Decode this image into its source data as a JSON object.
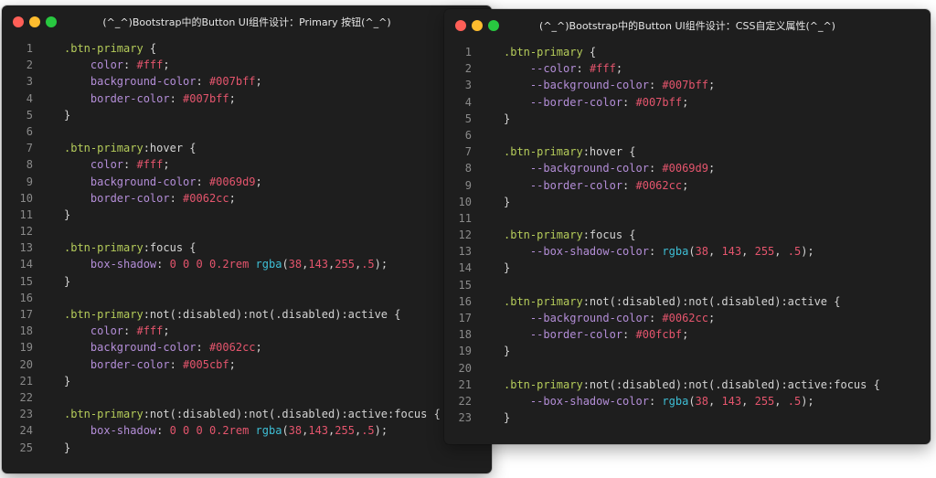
{
  "colors": {
    "selector": "#b5cc5a",
    "property": "#b48ed8",
    "value": "#e5556d",
    "function": "#3ebfd6",
    "plain": "#d4d4d4",
    "line_number": "#8a8a8a",
    "window_bg": "#1e1e1e"
  },
  "windows": [
    {
      "title": "(^_^)Bootstrap中的Button UI组件设计：Primary 按钮(^_^)",
      "lines": [
        {
          "n": "1",
          "tokens": [
            {
              "t": ".btn-primary",
              "k": "sel"
            },
            {
              "t": " {",
              "k": "punc"
            }
          ]
        },
        {
          "n": "2",
          "tokens": [
            {
              "t": "    color",
              "k": "prop"
            },
            {
              "t": ": ",
              "k": "punc"
            },
            {
              "t": "#fff",
              "k": "val"
            },
            {
              "t": ";",
              "k": "punc"
            }
          ]
        },
        {
          "n": "3",
          "tokens": [
            {
              "t": "    background-color",
              "k": "prop"
            },
            {
              "t": ": ",
              "k": "punc"
            },
            {
              "t": "#007bff",
              "k": "val"
            },
            {
              "t": ";",
              "k": "punc"
            }
          ]
        },
        {
          "n": "4",
          "tokens": [
            {
              "t": "    border-color",
              "k": "prop"
            },
            {
              "t": ": ",
              "k": "punc"
            },
            {
              "t": "#007bff",
              "k": "val"
            },
            {
              "t": ";",
              "k": "punc"
            }
          ]
        },
        {
          "n": "5",
          "tokens": [
            {
              "t": "}",
              "k": "punc"
            }
          ]
        },
        {
          "n": "6",
          "tokens": []
        },
        {
          "n": "7",
          "tokens": [
            {
              "t": ".btn-primary",
              "k": "sel"
            },
            {
              "t": ":hover",
              "k": "pseudo"
            },
            {
              "t": " {",
              "k": "punc"
            }
          ]
        },
        {
          "n": "8",
          "tokens": [
            {
              "t": "    color",
              "k": "prop"
            },
            {
              "t": ": ",
              "k": "punc"
            },
            {
              "t": "#fff",
              "k": "val"
            },
            {
              "t": ";",
              "k": "punc"
            }
          ]
        },
        {
          "n": "9",
          "tokens": [
            {
              "t": "    background-color",
              "k": "prop"
            },
            {
              "t": ": ",
              "k": "punc"
            },
            {
              "t": "#0069d9",
              "k": "val"
            },
            {
              "t": ";",
              "k": "punc"
            }
          ]
        },
        {
          "n": "10",
          "tokens": [
            {
              "t": "    border-color",
              "k": "prop"
            },
            {
              "t": ": ",
              "k": "punc"
            },
            {
              "t": "#0062cc",
              "k": "val"
            },
            {
              "t": ";",
              "k": "punc"
            }
          ]
        },
        {
          "n": "11",
          "tokens": [
            {
              "t": "}",
              "k": "punc"
            }
          ]
        },
        {
          "n": "12",
          "tokens": []
        },
        {
          "n": "13",
          "tokens": [
            {
              "t": ".btn-primary",
              "k": "sel"
            },
            {
              "t": ":focus",
              "k": "pseudo"
            },
            {
              "t": " {",
              "k": "punc"
            }
          ]
        },
        {
          "n": "14",
          "tokens": [
            {
              "t": "    box-shadow",
              "k": "prop"
            },
            {
              "t": ": ",
              "k": "punc"
            },
            {
              "t": "0 0 0 0.2rem ",
              "k": "val"
            },
            {
              "t": "rgba",
              "k": "fn"
            },
            {
              "t": "(",
              "k": "punc"
            },
            {
              "t": "38",
              "k": "val"
            },
            {
              "t": ",",
              "k": "punc"
            },
            {
              "t": "143",
              "k": "val"
            },
            {
              "t": ",",
              "k": "punc"
            },
            {
              "t": "255",
              "k": "val"
            },
            {
              "t": ",",
              "k": "punc"
            },
            {
              "t": ".5",
              "k": "val"
            },
            {
              "t": ");",
              "k": "punc"
            }
          ]
        },
        {
          "n": "15",
          "tokens": [
            {
              "t": "}",
              "k": "punc"
            }
          ]
        },
        {
          "n": "16",
          "tokens": []
        },
        {
          "n": "17",
          "tokens": [
            {
              "t": ".btn-primary",
              "k": "sel"
            },
            {
              "t": ":not(:disabled):not(.disabled):active",
              "k": "pseudo"
            },
            {
              "t": " {",
              "k": "punc"
            }
          ]
        },
        {
          "n": "18",
          "tokens": [
            {
              "t": "    color",
              "k": "prop"
            },
            {
              "t": ": ",
              "k": "punc"
            },
            {
              "t": "#fff",
              "k": "val"
            },
            {
              "t": ";",
              "k": "punc"
            }
          ]
        },
        {
          "n": "19",
          "tokens": [
            {
              "t": "    background-color",
              "k": "prop"
            },
            {
              "t": ": ",
              "k": "punc"
            },
            {
              "t": "#0062cc",
              "k": "val"
            },
            {
              "t": ";",
              "k": "punc"
            }
          ]
        },
        {
          "n": "20",
          "tokens": [
            {
              "t": "    border-color",
              "k": "prop"
            },
            {
              "t": ": ",
              "k": "punc"
            },
            {
              "t": "#005cbf",
              "k": "val"
            },
            {
              "t": ";",
              "k": "punc"
            }
          ]
        },
        {
          "n": "21",
          "tokens": [
            {
              "t": "}",
              "k": "punc"
            }
          ]
        },
        {
          "n": "22",
          "tokens": []
        },
        {
          "n": "23",
          "tokens": [
            {
              "t": ".btn-primary",
              "k": "sel"
            },
            {
              "t": ":not(:disabled):not(.disabled):active:focus",
              "k": "pseudo"
            },
            {
              "t": " {",
              "k": "punc"
            }
          ]
        },
        {
          "n": "24",
          "tokens": [
            {
              "t": "    box-shadow",
              "k": "prop"
            },
            {
              "t": ": ",
              "k": "punc"
            },
            {
              "t": "0 0 0 0.2rem ",
              "k": "val"
            },
            {
              "t": "rgba",
              "k": "fn"
            },
            {
              "t": "(",
              "k": "punc"
            },
            {
              "t": "38",
              "k": "val"
            },
            {
              "t": ",",
              "k": "punc"
            },
            {
              "t": "143",
              "k": "val"
            },
            {
              "t": ",",
              "k": "punc"
            },
            {
              "t": "255",
              "k": "val"
            },
            {
              "t": ",",
              "k": "punc"
            },
            {
              "t": ".5",
              "k": "val"
            },
            {
              "t": ");",
              "k": "punc"
            }
          ]
        },
        {
          "n": "25",
          "tokens": [
            {
              "t": "}",
              "k": "punc"
            }
          ]
        }
      ]
    },
    {
      "title": "(^_^)Bootstrap中的Button UI组件设计：CSS自定义属性(^_^)",
      "lines": [
        {
          "n": "1",
          "tokens": [
            {
              "t": ".btn-primary",
              "k": "sel"
            },
            {
              "t": " {",
              "k": "punc"
            }
          ]
        },
        {
          "n": "2",
          "tokens": [
            {
              "t": "    --color",
              "k": "prop"
            },
            {
              "t": ": ",
              "k": "punc"
            },
            {
              "t": "#fff",
              "k": "val"
            },
            {
              "t": ";",
              "k": "punc"
            }
          ]
        },
        {
          "n": "3",
          "tokens": [
            {
              "t": "    --background-color",
              "k": "prop"
            },
            {
              "t": ": ",
              "k": "punc"
            },
            {
              "t": "#007bff",
              "k": "val"
            },
            {
              "t": ";",
              "k": "punc"
            }
          ]
        },
        {
          "n": "4",
          "tokens": [
            {
              "t": "    --border-color",
              "k": "prop"
            },
            {
              "t": ": ",
              "k": "punc"
            },
            {
              "t": "#007bff",
              "k": "val"
            },
            {
              "t": ";",
              "k": "punc"
            }
          ]
        },
        {
          "n": "5",
          "tokens": [
            {
              "t": "}",
              "k": "punc"
            }
          ]
        },
        {
          "n": "6",
          "tokens": []
        },
        {
          "n": "7",
          "tokens": [
            {
              "t": ".btn-primary",
              "k": "sel"
            },
            {
              "t": ":hover",
              "k": "pseudo"
            },
            {
              "t": " {",
              "k": "punc"
            }
          ]
        },
        {
          "n": "8",
          "tokens": [
            {
              "t": "    --background-color",
              "k": "prop"
            },
            {
              "t": ": ",
              "k": "punc"
            },
            {
              "t": "#0069d9",
              "k": "val"
            },
            {
              "t": ";",
              "k": "punc"
            }
          ]
        },
        {
          "n": "9",
          "tokens": [
            {
              "t": "    --border-color",
              "k": "prop"
            },
            {
              "t": ": ",
              "k": "punc"
            },
            {
              "t": "#0062cc",
              "k": "val"
            },
            {
              "t": ";",
              "k": "punc"
            }
          ]
        },
        {
          "n": "10",
          "tokens": [
            {
              "t": "}",
              "k": "punc"
            }
          ]
        },
        {
          "n": "11",
          "tokens": []
        },
        {
          "n": "12",
          "tokens": [
            {
              "t": ".btn-primary",
              "k": "sel"
            },
            {
              "t": ":focus",
              "k": "pseudo"
            },
            {
              "t": " {",
              "k": "punc"
            }
          ]
        },
        {
          "n": "13",
          "tokens": [
            {
              "t": "    --box-shadow-color",
              "k": "prop"
            },
            {
              "t": ": ",
              "k": "punc"
            },
            {
              "t": "rgba",
              "k": "fn"
            },
            {
              "t": "(",
              "k": "punc"
            },
            {
              "t": "38",
              "k": "val"
            },
            {
              "t": ", ",
              "k": "punc"
            },
            {
              "t": "143",
              "k": "val"
            },
            {
              "t": ", ",
              "k": "punc"
            },
            {
              "t": "255",
              "k": "val"
            },
            {
              "t": ", ",
              "k": "punc"
            },
            {
              "t": ".5",
              "k": "val"
            },
            {
              "t": ");",
              "k": "punc"
            }
          ]
        },
        {
          "n": "14",
          "tokens": [
            {
              "t": "}",
              "k": "punc"
            }
          ]
        },
        {
          "n": "15",
          "tokens": []
        },
        {
          "n": "16",
          "tokens": [
            {
              "t": ".btn-primary",
              "k": "sel"
            },
            {
              "t": ":not(:disabled):not(.disabled):active",
              "k": "pseudo"
            },
            {
              "t": " {",
              "k": "punc"
            }
          ]
        },
        {
          "n": "17",
          "tokens": [
            {
              "t": "    --background-color",
              "k": "prop"
            },
            {
              "t": ": ",
              "k": "punc"
            },
            {
              "t": "#0062cc",
              "k": "val"
            },
            {
              "t": ";",
              "k": "punc"
            }
          ]
        },
        {
          "n": "18",
          "tokens": [
            {
              "t": "    --border-color",
              "k": "prop"
            },
            {
              "t": ": ",
              "k": "punc"
            },
            {
              "t": "#00fcbf",
              "k": "val"
            },
            {
              "t": ";",
              "k": "punc"
            }
          ]
        },
        {
          "n": "19",
          "tokens": [
            {
              "t": "}",
              "k": "punc"
            }
          ]
        },
        {
          "n": "20",
          "tokens": []
        },
        {
          "n": "21",
          "tokens": [
            {
              "t": ".btn-primary",
              "k": "sel"
            },
            {
              "t": ":not(:disabled):not(.disabled):active:focus",
              "k": "pseudo"
            },
            {
              "t": " {",
              "k": "punc"
            }
          ]
        },
        {
          "n": "22",
          "tokens": [
            {
              "t": "    --box-shadow-color",
              "k": "prop"
            },
            {
              "t": ": ",
              "k": "punc"
            },
            {
              "t": "rgba",
              "k": "fn"
            },
            {
              "t": "(",
              "k": "punc"
            },
            {
              "t": "38",
              "k": "val"
            },
            {
              "t": ", ",
              "k": "punc"
            },
            {
              "t": "143",
              "k": "val"
            },
            {
              "t": ", ",
              "k": "punc"
            },
            {
              "t": "255",
              "k": "val"
            },
            {
              "t": ", ",
              "k": "punc"
            },
            {
              "t": ".5",
              "k": "val"
            },
            {
              "t": ");",
              "k": "punc"
            }
          ]
        },
        {
          "n": "23",
          "tokens": [
            {
              "t": "}",
              "k": "punc"
            }
          ]
        }
      ]
    }
  ]
}
